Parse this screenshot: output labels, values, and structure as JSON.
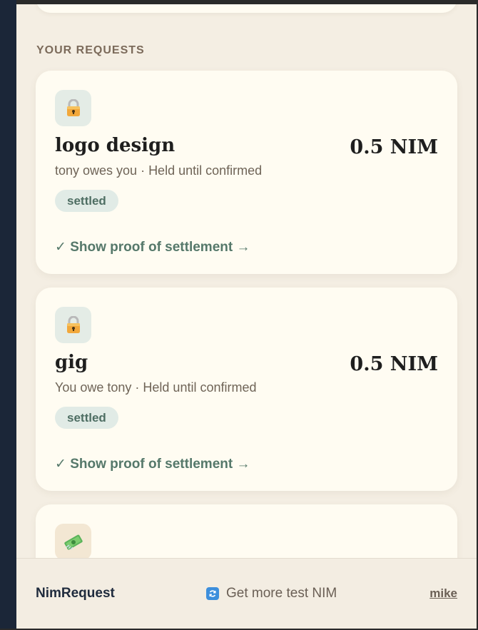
{
  "section": {
    "title": "YOUR REQUESTS"
  },
  "requests": [
    {
      "icon": "lock-icon",
      "title": "logo design",
      "amount": "0.5 NIM",
      "subtitle": "tony owes you · Held until confirmed",
      "status": "settled",
      "proof_link": "✓ Show proof of settlement →"
    },
    {
      "icon": "lock-icon",
      "title": "gig",
      "amount": "0.5 NIM",
      "subtitle": "You owe tony · Held until confirmed",
      "status": "settled",
      "proof_link": "✓ Show proof of settlement →"
    },
    {
      "icon": "money-icon"
    }
  ],
  "footer": {
    "brand": "NimRequest",
    "faucet_label": "Get more test NIM",
    "faucet_icon": "refresh-icon",
    "user": "mike"
  },
  "colors": {
    "background": "#f4eee3",
    "card": "#fffcf2",
    "badge_bg": "#e1ebe6",
    "badge_text": "#4e6e63",
    "link": "#55786a",
    "sidebar": "#1b2638"
  }
}
